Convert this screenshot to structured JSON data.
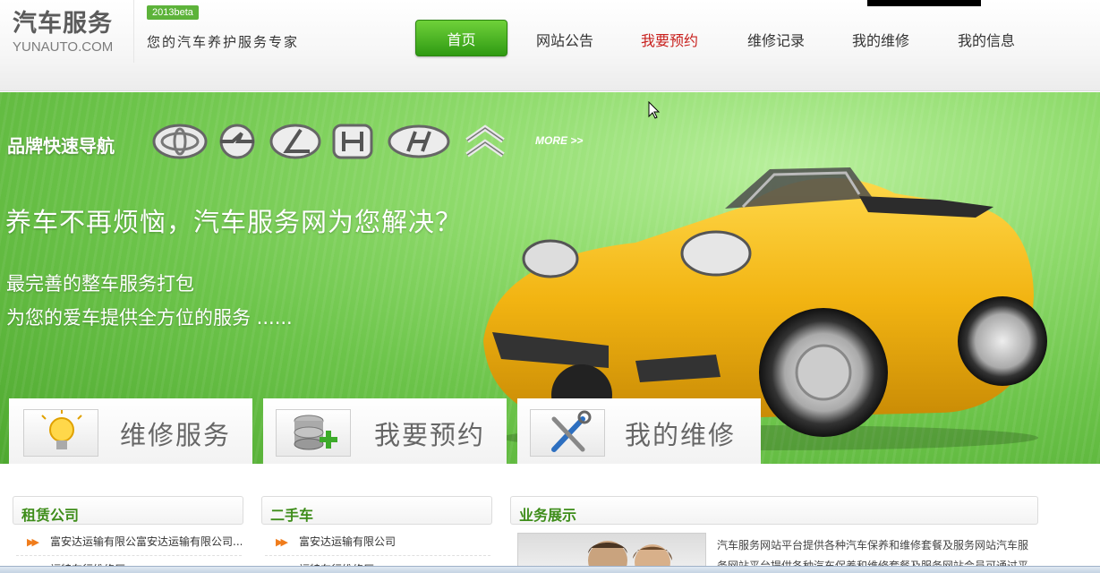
{
  "header": {
    "logo_title": "汽车服务",
    "logo_sub": "YUNAUTO.COM",
    "beta": "2013beta",
    "slogan": "您的汽车养护服务专家"
  },
  "nav": {
    "items": [
      {
        "label": "首页",
        "active_style": "button"
      },
      {
        "label": "网站公告"
      },
      {
        "label": "我要预约",
        "highlight": true
      },
      {
        "label": "维修记录"
      },
      {
        "label": "我的维修"
      },
      {
        "label": "我的信息"
      }
    ]
  },
  "banner": {
    "brand_nav_label": "品牌快速导航",
    "brands": [
      "toyota-logo",
      "opel-logo",
      "lexus-logo",
      "honda-logo",
      "hyundai-logo",
      "citroen-logo"
    ],
    "more": "MORE >>",
    "headline": "养车不再烦恼，汽车服务网为您解决？",
    "lines": [
      "最完善的整车服务打包",
      "为您的爱车提供全方位的服务 ......"
    ]
  },
  "features": [
    {
      "label": "维修服务",
      "icon": "lightbulb-icon"
    },
    {
      "label": "我要预约",
      "icon": "database-add-icon"
    },
    {
      "label": "我的维修",
      "icon": "tools-icon"
    }
  ],
  "panels": {
    "rental": {
      "title": "租赁公司",
      "rows": [
        "富安达运输有限公富安达运输有限公司...",
        "福特车行维修厂"
      ]
    },
    "used_car": {
      "title": "二手车",
      "rows": [
        "富安达运输有限公司",
        "福特车行维修厂"
      ]
    },
    "business": {
      "title": "业务展示",
      "text": "汽车服务网站平台提供各种汽车保养和维修套餐及服务网站汽车服务网站平台提供各种汽车保养和维修套餐及服务网站会员可通过平"
    }
  },
  "colors": {
    "accent_green": "#3e8d1a",
    "nav_active_red": "#c8201d",
    "car_yellow": "#f2b412"
  }
}
